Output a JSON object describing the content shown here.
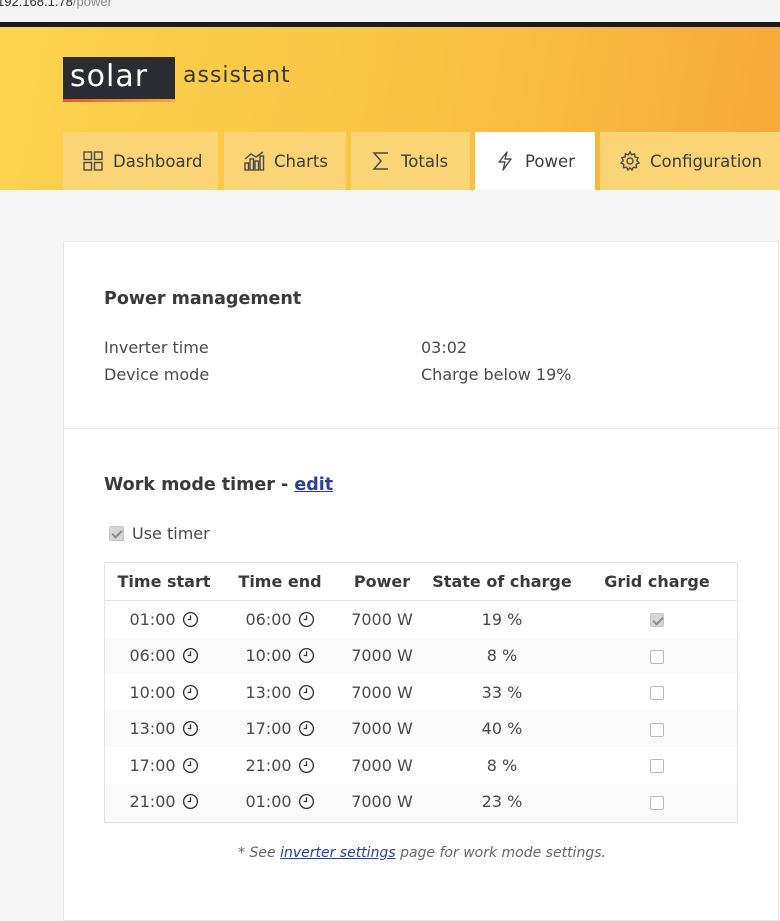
{
  "browser": {
    "url_host": "192.168.1.78",
    "url_path": "/power"
  },
  "logo": {
    "main": "solar",
    "sub": "assistant"
  },
  "tabs": [
    {
      "label": "Dashboard",
      "icon": "dashboard-grid-icon"
    },
    {
      "label": "Charts",
      "icon": "bar-chart-icon"
    },
    {
      "label": "Totals",
      "icon": "sigma-icon"
    },
    {
      "label": "Power",
      "icon": "lightning-icon",
      "active": true
    },
    {
      "label": "Configuration",
      "icon": "gear-icon"
    }
  ],
  "power_management": {
    "title": "Power management",
    "rows": [
      {
        "label": "Inverter time",
        "value": "03:02"
      },
      {
        "label": "Device mode",
        "value": "Charge below 19%"
      }
    ]
  },
  "work_mode_timer": {
    "title": "Work mode timer - ",
    "edit_label": "edit",
    "use_timer_label": "Use timer",
    "use_timer_checked": true,
    "columns": [
      "Time start",
      "Time end",
      "Power",
      "State of charge",
      "Grid charge"
    ],
    "rows": [
      {
        "start": "01:00",
        "end": "06:00",
        "power": "7000 W",
        "soc": "19 %",
        "grid_charge": true
      },
      {
        "start": "06:00",
        "end": "10:00",
        "power": "7000 W",
        "soc": "8 %",
        "grid_charge": false
      },
      {
        "start": "10:00",
        "end": "13:00",
        "power": "7000 W",
        "soc": "33 %",
        "grid_charge": false
      },
      {
        "start": "13:00",
        "end": "17:00",
        "power": "7000 W",
        "soc": "40 %",
        "grid_charge": false
      },
      {
        "start": "17:00",
        "end": "21:00",
        "power": "7000 W",
        "soc": "8 %",
        "grid_charge": false
      },
      {
        "start": "21:00",
        "end": "01:00",
        "power": "7000 W",
        "soc": "23 %",
        "grid_charge": false
      }
    ],
    "note_prefix": "* See ",
    "note_link": "inverter settings",
    "note_suffix": " page for work mode settings."
  },
  "colors": {
    "header_start": "#fcd34f",
    "header_end": "#f5a93a",
    "tab_bg": "#fbd475",
    "link": "#2c3e9a",
    "logo_bg": "#2b2b33"
  }
}
